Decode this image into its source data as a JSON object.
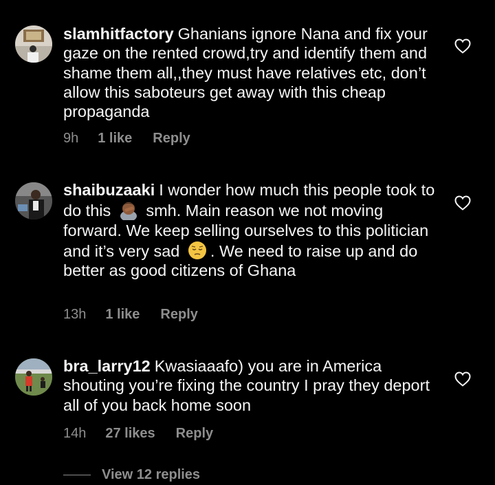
{
  "comments": [
    {
      "username": "slamhitfactory",
      "text": "Ghanians ignore Nana and fix your gaze on the rented crowd,try and identify them and shame them all,,they must have relatives etc, don’t allow this saboteurs get away with this cheap propaganda",
      "time": "9h",
      "likes": "1 like",
      "reply": "Reply"
    },
    {
      "username": "shaibuzaaki",
      "text_1": "I wonder how much this people took to do this",
      "emoji_1": "person-facepalming-emoji",
      "text_2": "smh. Main reason we not moving forward. We keep selling ourselves to this politician and it’s very sad",
      "emoji_2": "pensive-face-emoji",
      "text_3": ". We need to raise up and do better as good citizens of Ghana",
      "time": "13h",
      "likes": "1 like",
      "reply": "Reply"
    },
    {
      "username": "bra_larry12",
      "text": "Kwasiaaafo) you are in America shouting you’re fixing the country I pray they deport all of you back home soon",
      "time": "14h",
      "likes": "27 likes",
      "reply": "Reply"
    }
  ],
  "view_replies": "View 12 replies",
  "colors": {
    "background": "#000000",
    "text": "#f5f5f5",
    "meta": "#8e8e8e"
  },
  "icons": {
    "like": "heart-outline-icon"
  }
}
